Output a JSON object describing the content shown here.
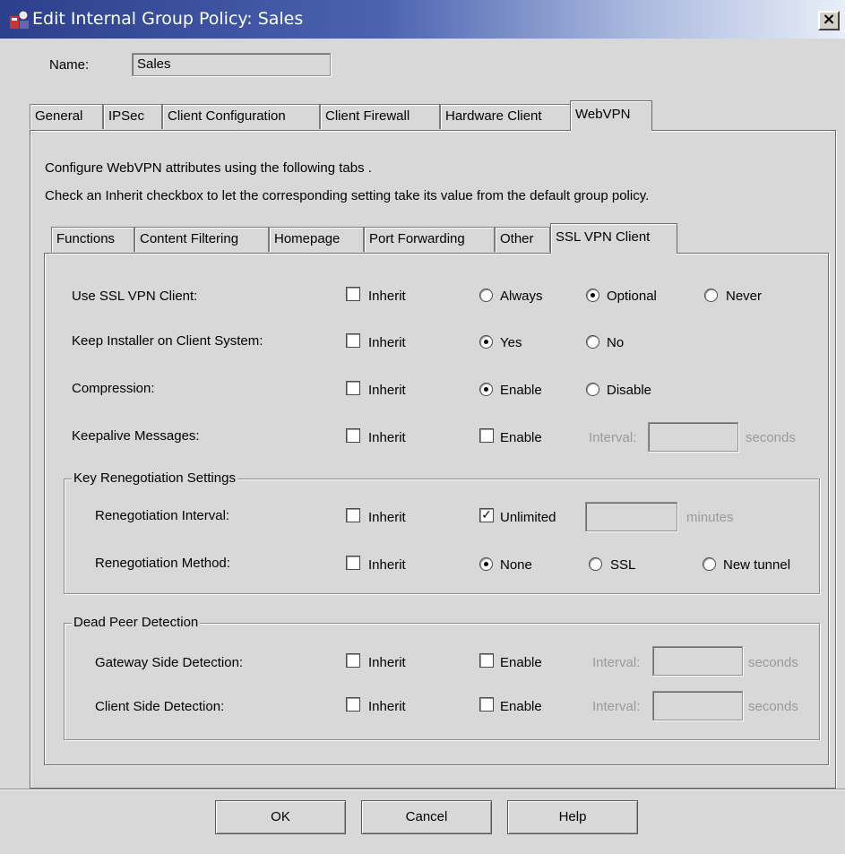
{
  "window": {
    "title": "Edit Internal Group Policy: Sales",
    "close_label": "×"
  },
  "name_row": {
    "label": "Name:",
    "value": "Sales"
  },
  "outer_tabs": [
    "General",
    "IPSec",
    "Client Configuration",
    "Client Firewall",
    "Hardware Client",
    "WebVPN"
  ],
  "outer_tabs_active": "WebVPN",
  "info": {
    "line1": "Configure WebVPN attributes using the following tabs .",
    "line2": "Check an Inherit checkbox to let the corresponding setting take its value from the default group policy."
  },
  "inner_tabs": [
    "Functions",
    "Content Filtering",
    "Homepage",
    "Port Forwarding",
    "Other",
    "SSL VPN Client"
  ],
  "inner_tabs_active": "SSL VPN Client",
  "rows": {
    "use_ssl": {
      "label": "Use SSL VPN Client:",
      "inherit": "Inherit",
      "always": "Always",
      "optional": "Optional",
      "never": "Never",
      "selected": "Optional"
    },
    "keep_installer": {
      "label": "Keep Installer on Client System:",
      "inherit": "Inherit",
      "yes": "Yes",
      "no": "No",
      "selected": "Yes"
    },
    "compression": {
      "label": "Compression:",
      "inherit": "Inherit",
      "enable": "Enable",
      "disable": "Disable",
      "selected": "Enable"
    },
    "keepalive": {
      "label": "Keepalive Messages:",
      "inherit": "Inherit",
      "enable": "Enable",
      "interval_label": "Interval:",
      "interval_value": "",
      "unit": "seconds"
    }
  },
  "key_reneg": {
    "legend": "Key Renegotiation Settings",
    "interval": {
      "label": "Renegotiation Interval:",
      "inherit": "Inherit",
      "unlimited": "Unlimited",
      "unlimited_checked": true,
      "value": "",
      "unit": "minutes"
    },
    "method": {
      "label": "Renegotiation Method:",
      "inherit": "Inherit",
      "none": "None",
      "ssl": "SSL",
      "new_tunnel": "New tunnel",
      "selected": "None"
    }
  },
  "dpd": {
    "legend": "Dead Peer Detection",
    "gateway": {
      "label": "Gateway Side Detection:",
      "inherit": "Inherit",
      "enable": "Enable",
      "interval_label": "Interval:",
      "value": "",
      "unit": "seconds"
    },
    "client": {
      "label": "Client Side Detection:",
      "inherit": "Inherit",
      "enable": "Enable",
      "interval_label": "Interval:",
      "value": "",
      "unit": "seconds"
    }
  },
  "buttons": {
    "ok": "OK",
    "cancel": "Cancel",
    "help": "Help"
  },
  "check_mark": "✓",
  "colors": {
    "title_gradient_start": "#2c3f8c",
    "title_gradient_end": "#e9eef8",
    "window_bg": "#d8d8d8"
  }
}
